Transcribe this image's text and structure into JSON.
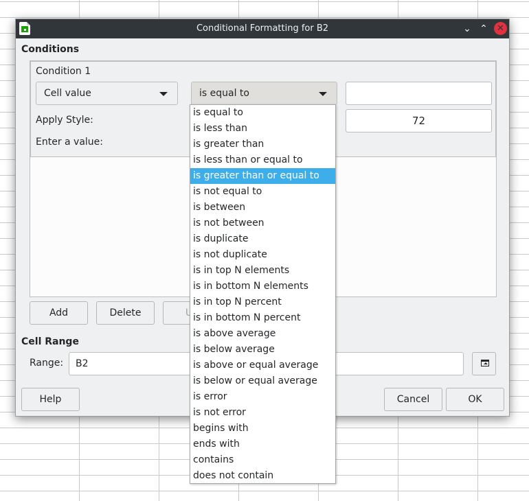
{
  "dialog": {
    "title": "Conditional Formatting for B2",
    "app_icon": "calc-spreadsheet-icon",
    "window_buttons": [
      "minimize-icon",
      "maximize-icon",
      "close-icon"
    ]
  },
  "conditions": {
    "section_label": "Conditions",
    "condition_label": "Condition 1",
    "type_combo": "Cell value",
    "operator_combo": "is equal to",
    "value_field": "",
    "apply_style_label": "Apply Style:",
    "enter_value_label": "Enter a value:",
    "enter_value_field": "72"
  },
  "buttons": {
    "add": "Add",
    "delete": "Delete",
    "up": "Up",
    "help": "Help",
    "cancel": "Cancel",
    "ok": "OK"
  },
  "cell_range": {
    "section_label": "Cell Range",
    "range_label": "Range:",
    "range_value": "B2",
    "shrink_icon": "shrink-range-icon"
  },
  "operator_dropdown": {
    "selected_index": 4,
    "options": [
      "is equal to",
      "is less than",
      "is greater than",
      "is less than or equal to",
      "is greater than or equal to",
      "is not equal to",
      "is between",
      "is not between",
      "is duplicate",
      "is not duplicate",
      "is in top N elements",
      "is in bottom N elements",
      "is in top N percent",
      "is in bottom N percent",
      "is above average",
      "is below average",
      "is above or equal average",
      "is below or equal average",
      "is error",
      "is not error",
      "begins with",
      "ends with",
      "contains",
      "does not contain"
    ]
  },
  "colors": {
    "titlebar": "#31363b",
    "selection": "#3daee9",
    "close_button": "#e2313f",
    "dialog_bg": "#eff0f1"
  }
}
